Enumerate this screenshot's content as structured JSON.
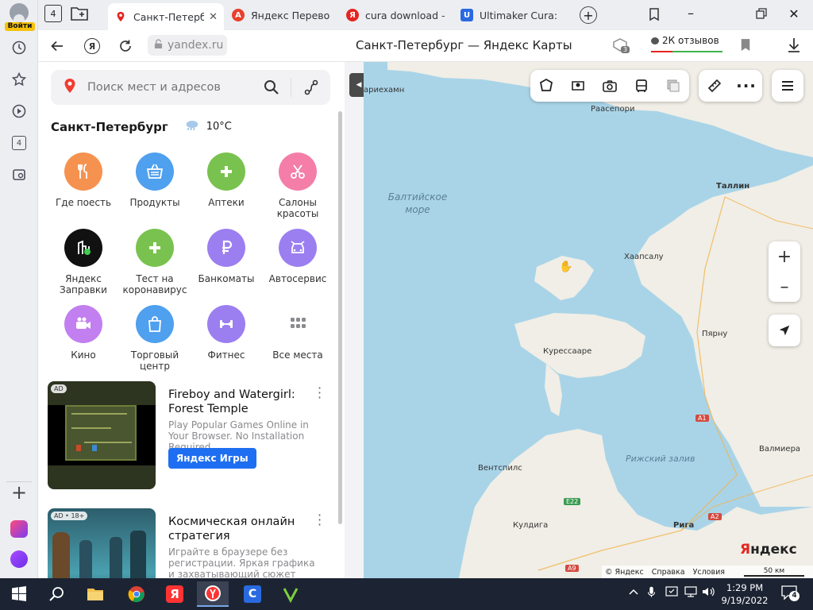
{
  "sidebar": {
    "login_label": "Войти",
    "tabs_count": "4"
  },
  "tabs": {
    "group_count": "4",
    "items": [
      {
        "label": "Санкт-Петерб",
        "favicon": "map-pin",
        "color": "#e52520"
      },
      {
        "label": "Яндекс Перевод",
        "favicon": "translate",
        "color": "#e8402c"
      },
      {
        "label": "cura download –",
        "favicon": "yandex",
        "color": "#e52520"
      },
      {
        "label": "Ultimaker Cura: F",
        "favicon": "ultimaker",
        "color": "#2a6ae0"
      }
    ]
  },
  "addressbar": {
    "url": "yandex.ru",
    "page_title": "Санкт-Петербург — Яндекс Карты",
    "reviews": "2К отзывов",
    "badge_count": "3"
  },
  "panel": {
    "search_placeholder": "Поиск мест и адресов",
    "city": "Санкт-Петербург",
    "temperature": "10°C",
    "categories": [
      {
        "label": "Где поесть",
        "icon": "fork-knife-icon",
        "color": "#f6924f"
      },
      {
        "label": "Продукты",
        "icon": "basket-icon",
        "color": "#4fa0ee"
      },
      {
        "label": "Аптеки",
        "icon": "cross-icon",
        "color": "#79c24f"
      },
      {
        "label": "Салоны красоты",
        "icon": "scissors-icon",
        "color": "#f47ea8"
      },
      {
        "label": "Яндекс Заправки",
        "icon": "fuel-icon",
        "color": "#111111"
      },
      {
        "label": "Тест на коронавирус",
        "icon": "cross-icon",
        "color": "#79c24f"
      },
      {
        "label": "Банкоматы",
        "icon": "ruble-icon",
        "color": "#9b7ff0"
      },
      {
        "label": "Автосервис",
        "icon": "car-icon",
        "color": "#9b7ff0"
      },
      {
        "label": "Кино",
        "icon": "camera-icon",
        "color": "#c27ff0"
      },
      {
        "label": "Торговый центр",
        "icon": "bag-icon",
        "color": "#4fa0ee"
      },
      {
        "label": "Фитнес",
        "icon": "dumbbell-icon",
        "color": "#9b7ff0"
      },
      {
        "label": "Все места",
        "icon": "grid-icon",
        "color": "#ffffff"
      }
    ],
    "ads": [
      {
        "tag": "AD",
        "title": "Fireboy and Watergirl: Forest Temple",
        "desc": "Play Popular Games Online in Your Browser. No Installation Required",
        "cta": "Яндекс Игры"
      },
      {
        "tag": "AD • 18+",
        "title": "Космическая онлайн стратегия",
        "desc": "Играйте в браузере без регистрации. Яркая графика и захватывающий сюжет"
      }
    ]
  },
  "map": {
    "labels": {
      "mariehamn": "ариехамн",
      "raasepori": "Раасепори",
      "tallinn": "Таллин",
      "baltic": "Балтийское море",
      "haapsalu": "Хаапсалу",
      "parnu": "Пярну",
      "kuressaare": "Курессааре",
      "riga_gulf": "Рижский залив",
      "ventspils": "Вентспилс",
      "valmiera": "Валмиера",
      "kuldiga": "Кулдига",
      "riga": "Рига"
    },
    "roads": {
      "a1": "A1",
      "a2": "A2",
      "e22": "E22",
      "a9": "A9"
    },
    "logo_ya": "Я",
    "logo_rest": "ндекс",
    "credits": {
      "copyright": "© Яндекс",
      "help": "Справка",
      "terms": "Условия",
      "scale": "50 км"
    }
  },
  "taskbar": {
    "time": "1:29 PM",
    "date": "9/19/2022",
    "notifications": "4"
  }
}
